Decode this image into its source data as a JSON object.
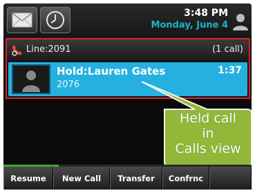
{
  "status_bar": {
    "time": "3:48 PM",
    "date": "Monday, June 4",
    "icons": [
      "envelope-icon",
      "clock-icon",
      "user-icon"
    ]
  },
  "line": {
    "label": "Line:2091",
    "call_count": "(1 call)",
    "icon": "phone-handset-icon"
  },
  "active_call": {
    "name": "Hold:Lauren Gates",
    "number": "2076",
    "timer": "1:37"
  },
  "callout": {
    "lines": [
      "Held call",
      "in",
      "Calls view"
    ],
    "color": "#9ac23c"
  },
  "softkeys": [
    "Resume",
    "New Call",
    "Transfer",
    "Confrnc",
    ""
  ],
  "colors": {
    "accent": "#25b0e0",
    "line_border": "#d9242a",
    "date": "#1fb3c9",
    "progress": "#3fa832"
  }
}
